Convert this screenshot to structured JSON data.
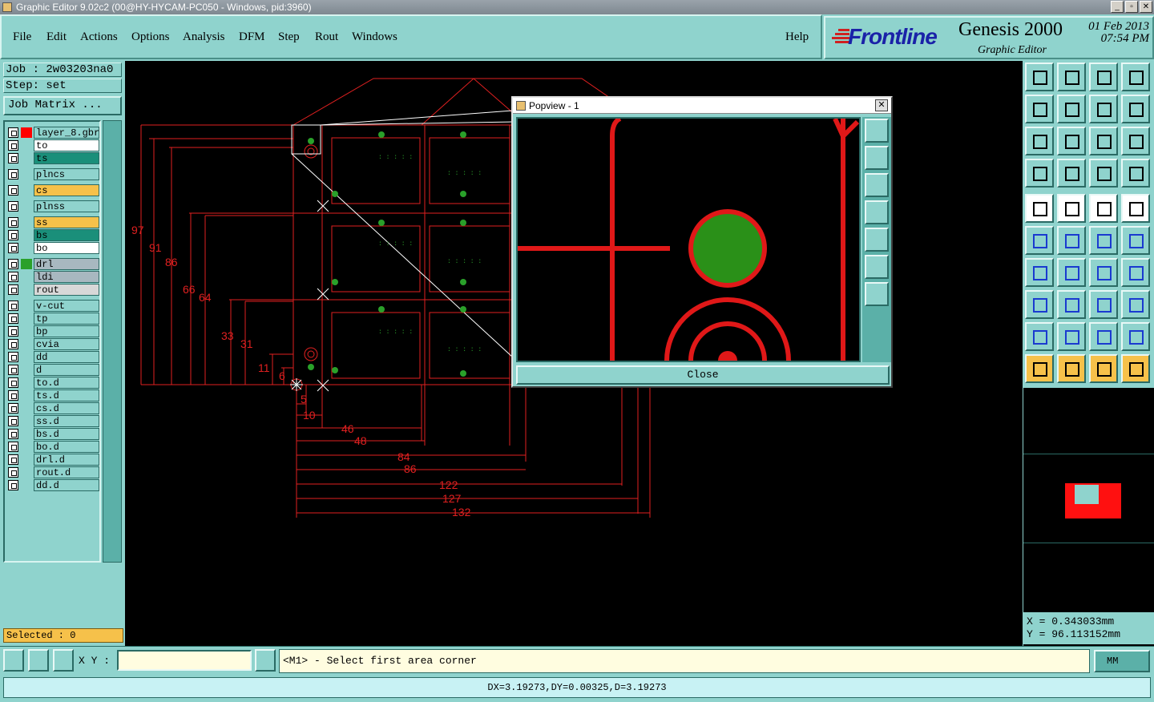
{
  "window": {
    "title": "Graphic Editor 9.02c2 (00@HY-HYCAM-PC050 - Windows, pid:3960)",
    "min": "_",
    "max": "▫",
    "close": "✕"
  },
  "menu": [
    "File",
    "Edit",
    "Actions",
    "Options",
    "Analysis",
    "DFM",
    "Step",
    "Rout",
    "Windows"
  ],
  "help": "Help",
  "brand": {
    "logo": "Frontline",
    "product": "Genesis 2000",
    "subtitle": "Graphic Editor",
    "date": "01 Feb 2013",
    "time": "07:54 PM"
  },
  "job": {
    "job_label": "Job : 2w03203na0",
    "step_label": "Step: set",
    "matrix_button": "Job Matrix ..."
  },
  "layers": [
    {
      "name": "layer_8.gbr",
      "color": "#ff0000",
      "fill": "#8fd3cd",
      "active": true
    },
    {
      "name": "to",
      "color": "",
      "fill": "#ffffff"
    },
    {
      "name": "ts",
      "color": "",
      "fill": "#1a8f7a"
    },
    {
      "name": "plncs",
      "color": "",
      "fill": "#8fd3cd"
    },
    {
      "name": "cs",
      "color": "",
      "fill": "#f6c14a"
    },
    {
      "name": "plnss",
      "color": "",
      "fill": "#8fd3cd"
    },
    {
      "name": "ss",
      "color": "",
      "fill": "#f6c14a"
    },
    {
      "name": "bs",
      "color": "",
      "fill": "#1a8f7a"
    },
    {
      "name": "bo",
      "color": "",
      "fill": "#ffffff"
    },
    {
      "name": "drl",
      "color": "#2aa02a",
      "fill": "#a8b8c0"
    },
    {
      "name": "ldi",
      "color": "",
      "fill": "#a8b8c0"
    },
    {
      "name": "rout",
      "color": "",
      "fill": "#d8d8d8"
    },
    {
      "name": "v-cut",
      "color": "",
      "fill": "#8fd3cd"
    },
    {
      "name": "tp",
      "color": "",
      "fill": "#8fd3cd"
    },
    {
      "name": "bp",
      "color": "",
      "fill": "#8fd3cd"
    },
    {
      "name": "cvia",
      "color": "",
      "fill": "#8fd3cd"
    },
    {
      "name": "dd",
      "color": "",
      "fill": "#8fd3cd"
    },
    {
      "name": "d",
      "color": "",
      "fill": "#8fd3cd"
    },
    {
      "name": "to.d",
      "color": "",
      "fill": "#8fd3cd"
    },
    {
      "name": "ts.d",
      "color": "",
      "fill": "#8fd3cd"
    },
    {
      "name": "cs.d",
      "color": "",
      "fill": "#8fd3cd"
    },
    {
      "name": "ss.d",
      "color": "",
      "fill": "#8fd3cd"
    },
    {
      "name": "bs.d",
      "color": "",
      "fill": "#8fd3cd"
    },
    {
      "name": "bo.d",
      "color": "",
      "fill": "#8fd3cd"
    },
    {
      "name": "drl.d",
      "color": "",
      "fill": "#8fd3cd"
    },
    {
      "name": "rout.d",
      "color": "",
      "fill": "#8fd3cd"
    },
    {
      "name": "dd.d",
      "color": "",
      "fill": "#8fd3cd"
    }
  ],
  "selected": "Selected : 0",
  "dimensions": {
    "vertical": [
      "97",
      "91",
      "86",
      "66",
      "64",
      "33",
      "31",
      "11",
      "6"
    ],
    "horizontal": [
      "5",
      "10",
      "46",
      "48",
      "84",
      "86",
      "122",
      "127",
      "132"
    ]
  },
  "popview": {
    "title": "Popview - 1",
    "close_label": "Close"
  },
  "coords": {
    "x": "X = 0.343033mm",
    "y": "Y = 96.113152mm"
  },
  "bottom": {
    "xy_label": "X Y :",
    "xy_value": "",
    "message": "<M1> - Select first area corner",
    "unit": "MM",
    "status": "DX=3.19273,DY=0.00325,D=3.19273"
  }
}
